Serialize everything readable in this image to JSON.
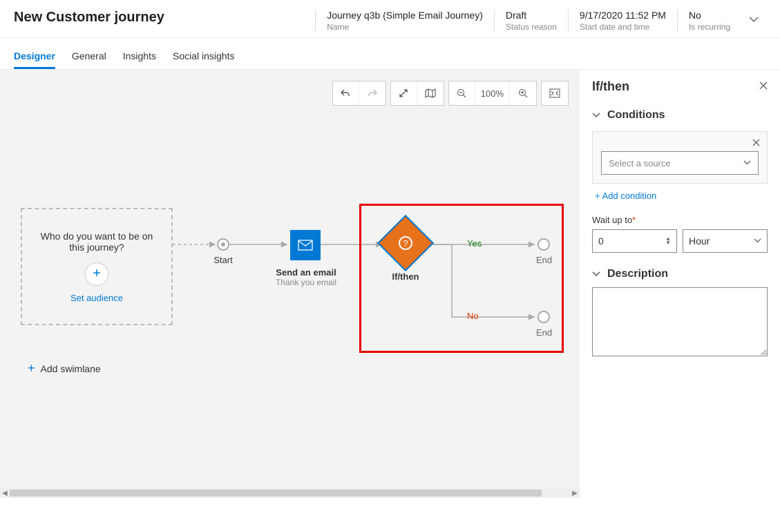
{
  "header": {
    "title": "New Customer journey",
    "fields": [
      {
        "value": "Journey q3b (Simple Email Journey)",
        "label": "Name"
      },
      {
        "value": "Draft",
        "label": "Status reason"
      },
      {
        "value": "9/17/2020 11:52 PM",
        "label": "Start date and time"
      },
      {
        "value": "No",
        "label": "Is recurring"
      }
    ]
  },
  "tabs": [
    "Designer",
    "General",
    "Insights",
    "Social insights"
  ],
  "activeTab": "Designer",
  "toolbar": {
    "zoom": "100%"
  },
  "canvas": {
    "audience": {
      "question": "Who do you want to be on this journey?",
      "link": "Set audience"
    },
    "start": "Start",
    "email": {
      "title": "Send an email",
      "subtitle": "Thank you email"
    },
    "ifthen": "If/then",
    "yes": "Yes",
    "no": "No",
    "end": "End",
    "addSwimlane": "Add swimlane"
  },
  "panel": {
    "title": "If/then",
    "sections": {
      "conditions": "Conditions",
      "description": "Description"
    },
    "sourcePlaceholder": "Select a source",
    "addCondition": "+ Add condition",
    "waitLabel": "Wait up to",
    "waitValue": "0",
    "waitUnit": "Hour",
    "descValue": ""
  }
}
